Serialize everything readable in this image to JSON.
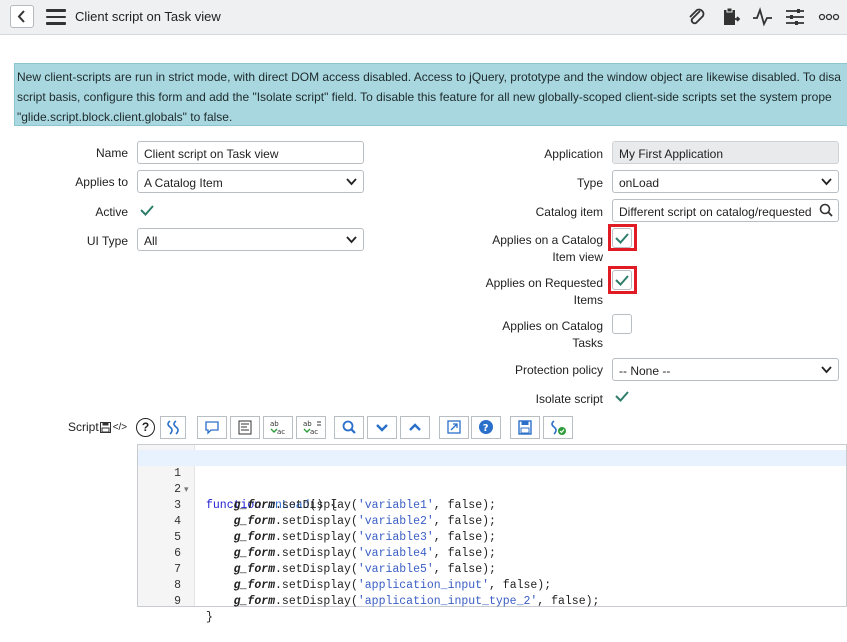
{
  "header": {
    "title": "Client script on Task view",
    "icons": [
      "paperclip-icon",
      "clipboard-icon",
      "activity-icon",
      "sliders-icon",
      "more-icon"
    ]
  },
  "banner": {
    "line1": "New client-scripts are run in strict mode, with direct DOM access disabled. Access to jQuery, prototype and the window object are likewise disabled. To disa",
    "line2": "script basis, configure this form and add the \"Isolate script\" field. To disable this feature for all new globally-scoped client-side scripts set the system prope",
    "line3": "\"glide.script.block.client.globals\" to false."
  },
  "form": {
    "name_label": "Name",
    "name_value": "Client script on Task view",
    "applies_to_label": "Applies to",
    "applies_to_value": "A Catalog Item",
    "active_label": "Active",
    "ui_type_label": "UI Type",
    "ui_type_value": "All",
    "application_label": "Application",
    "application_value": "My First Application",
    "type_label": "Type",
    "type_value": "onLoad",
    "catalog_item_label": "Catalog item",
    "catalog_item_value": "Different script on catalog/requested",
    "applies_catalog_view_label_1": "Applies on a Catalog",
    "applies_catalog_view_label_2": "Item view",
    "applies_requested_label_1": "Applies on Requested",
    "applies_requested_label_2": "Items",
    "applies_tasks_label_1": "Applies on Catalog",
    "applies_tasks_label_2": "Tasks",
    "protection_label": "Protection policy",
    "protection_value": "-- None --",
    "isolate_label": "Isolate script",
    "active_checked": true,
    "applies_catalog_view_checked": true,
    "applies_requested_checked": true,
    "applies_tasks_checked": false,
    "isolate_checked": true
  },
  "script": {
    "label": "Script",
    "tag_symbol": "</>",
    "help_symbol": "?",
    "lines": [
      {
        "n": "1",
        "fold": "▾"
      },
      {
        "n": "2"
      },
      {
        "n": "3"
      },
      {
        "n": "4"
      },
      {
        "n": "5"
      },
      {
        "n": "6"
      },
      {
        "n": "7"
      },
      {
        "n": "8"
      },
      {
        "n": "9"
      }
    ],
    "code": {
      "l1_kw": "function",
      "l1_fn": "onLoad",
      "l1_rest": "() {",
      "obj": "g_form",
      "method": ".setDisplay(",
      "args": [
        "'variable1'",
        "'variable2'",
        "'variable3'",
        "'variable4'",
        "'variable5'",
        "'application_input'",
        "'application_input_type_2'"
      ],
      "tail": ", false);",
      "close": "}"
    }
  },
  "colors": {
    "banner": "#a9d7df",
    "highlight": "#e01b24",
    "check": "#2e7d6b"
  }
}
